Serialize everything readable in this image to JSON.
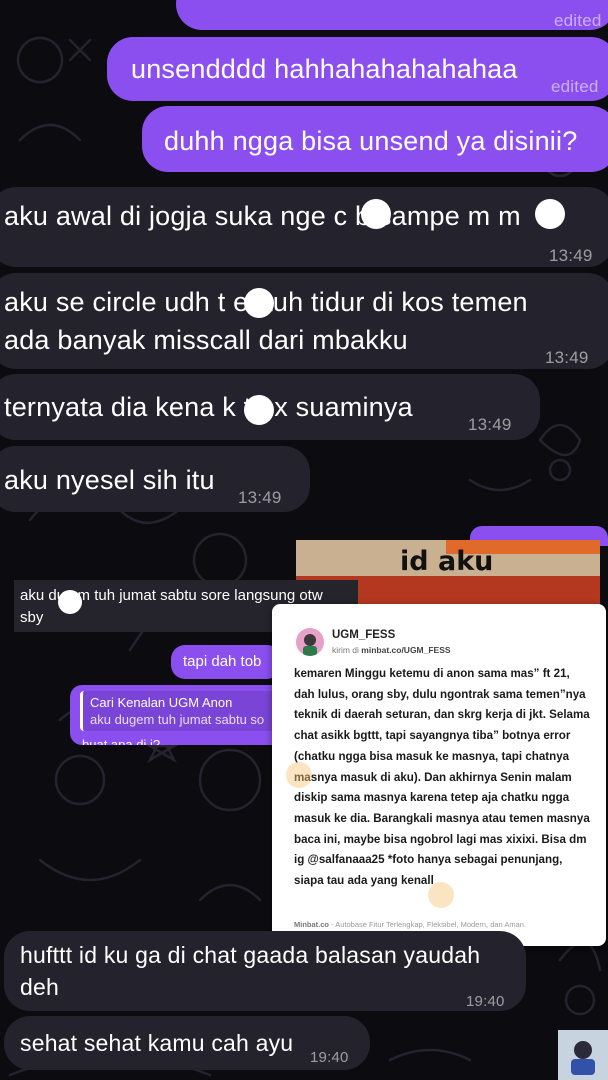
{
  "messages": [
    {
      "text": "",
      "meta": "edited"
    },
    {
      "text": "unsendddd hahhahahahahahaa",
      "meta": "edited"
    },
    {
      "text": "duhh ngga bisa unsend ya disinii?",
      "meta": ""
    },
    {
      "line1": "aku awal di jogja suka nge  c   b sampe m    m",
      "time": "13:49"
    },
    {
      "line1": "aku se circle udh t   er tuh tidur di kos temen",
      "line2": "ada banyak misscall dari mbakku",
      "time": "13:49"
    },
    {
      "line1": "ternyata dia kena k    t ex suaminya",
      "time": "13:49"
    },
    {
      "line1": "aku nyesel sih itu",
      "time": "13:49"
    }
  ],
  "embedded_chat": {
    "image_caption": "id aku",
    "incoming": {
      "line1": "aku du   em tuh jumat sabtu sore langsung otw",
      "line2": "sby"
    },
    "outgoing": "tapi dah tob",
    "reply": {
      "name": "Cari Kenalan UGM Anon",
      "text": "aku dugem tuh jumat sabtu so",
      "cut": "buat apa di j?"
    }
  },
  "post_card": {
    "name": "UGM_FESS",
    "sub_prefix": "kirim di",
    "sub_link": "minbat.co/UGM_FESS",
    "body": "kemaren Minggu ketemu di anon sama mas” ft 21, dah lulus, orang sby, dulu ngontrak sama temen”nya teknik di daerah seturan, dan skrg kerja di jkt. Selama chat asikk bgttt, tapi sayangnya tiba” botnya error (chatku ngga bisa masuk ke masnya, tapi chatnya masnya masuk di aku). Dan akhirnya Senin malam diskip sama masnya karena tetep aja chatku ngga masuk ke dia. Barangkali masnya atau temen masnya baca ini, maybe bisa ngobrol lagi mas xixixi. Bisa dm ig @salfanaaa25 *foto hanya sebagai penunjang, siapa tau ada yang kenall",
    "footer_brand": "Minbat.co",
    "footer_rest": " - Autobase Fitur Terlengkap, Fleksibel, Modern, dan Aman."
  },
  "bottom_messages": [
    {
      "line1": "hufttt id ku ga di chat gaada balasan yaudah",
      "line2": "deh",
      "time": "19:40"
    },
    {
      "line1": "sehat sehat kamu cah ayu",
      "time": "19:40"
    }
  ],
  "colors": {
    "outgoing": "#8b4ff0",
    "incoming": "#24222c",
    "background": "#0b0b10"
  }
}
